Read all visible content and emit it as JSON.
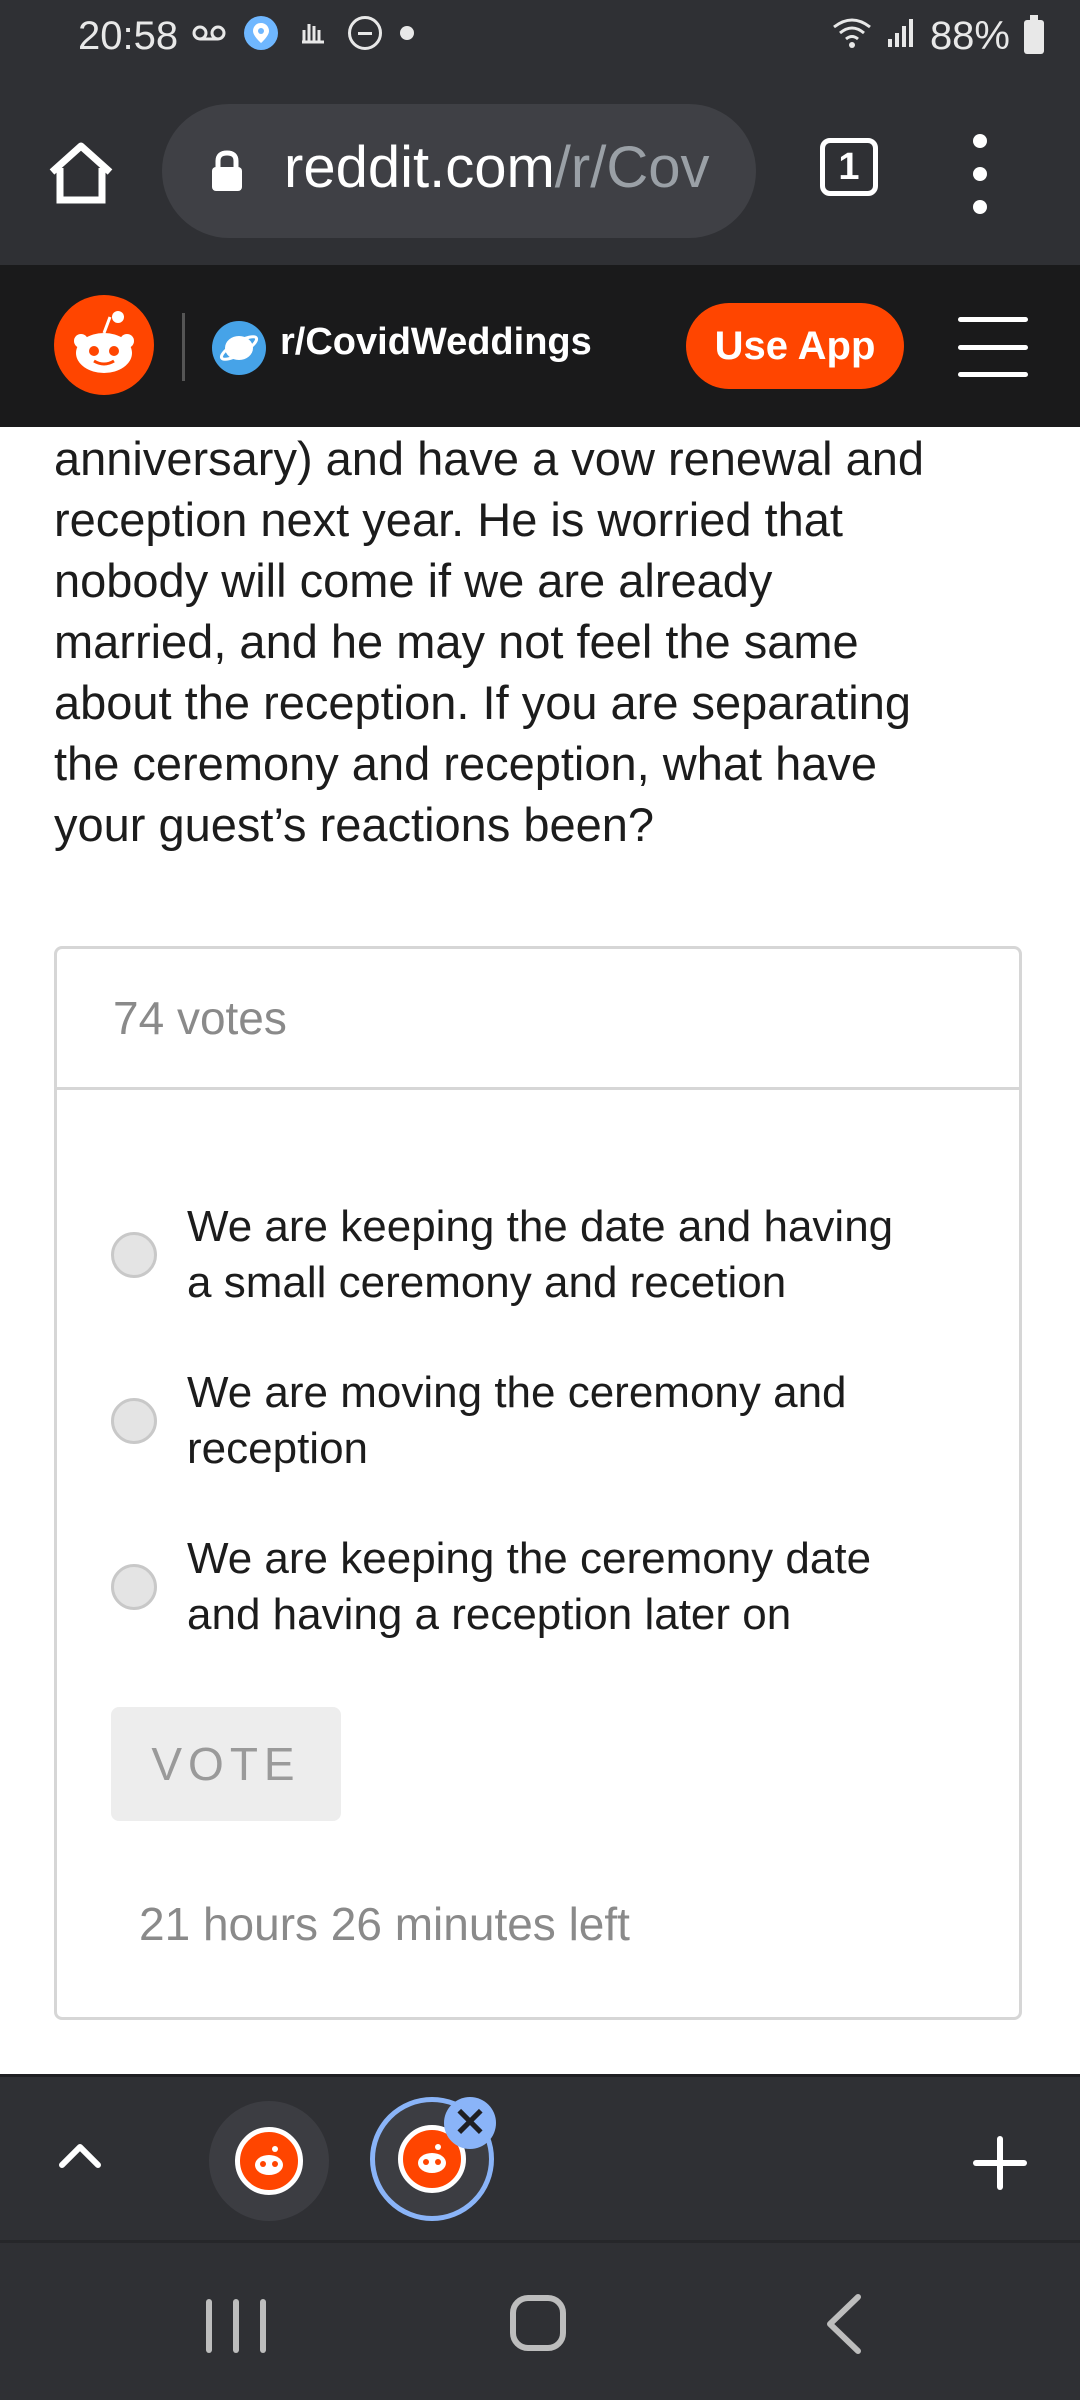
{
  "status_bar": {
    "time": "20:58",
    "battery": "88%",
    "icons": [
      "voicemail-icon",
      "location-icon",
      "gesture-icon",
      "dnd-icon",
      "dot-icon",
      "wifi-icon",
      "signal-icon",
      "battery-icon"
    ]
  },
  "browser": {
    "url_domain": "reddit.com",
    "url_path": "/r/Cov",
    "tab_count": "1"
  },
  "reddit_header": {
    "subreddit": "r/CovidWeddings",
    "use_app_label": "Use App"
  },
  "post": {
    "body_lines": [
      "anniversary) and have a vow renewal and",
      "reception next year. He is worried that",
      "nobody will come if we are already",
      "married, and he may not feel the same",
      "about the reception. If you are separating",
      "the ceremony and reception, what have",
      "your guest’s reactions been?"
    ]
  },
  "poll": {
    "votes": "74 votes",
    "options": [
      {
        "line1": "We are keeping the date and having",
        "line2": "a small ceremony and recetion"
      },
      {
        "line1": "We are moving the ceremony and",
        "line2": "reception"
      },
      {
        "line1": "We are keeping the ceremony date",
        "line2": "and having a reception later on"
      }
    ],
    "vote_label": "VOTE",
    "time_left": "21 hours 26 minutes left"
  },
  "colors": {
    "reddit_orange": "#ff4500",
    "chrome_dark": "#2f3034",
    "header_dark": "#1a1a1b",
    "active_tab_ring": "#8ab4f8"
  }
}
